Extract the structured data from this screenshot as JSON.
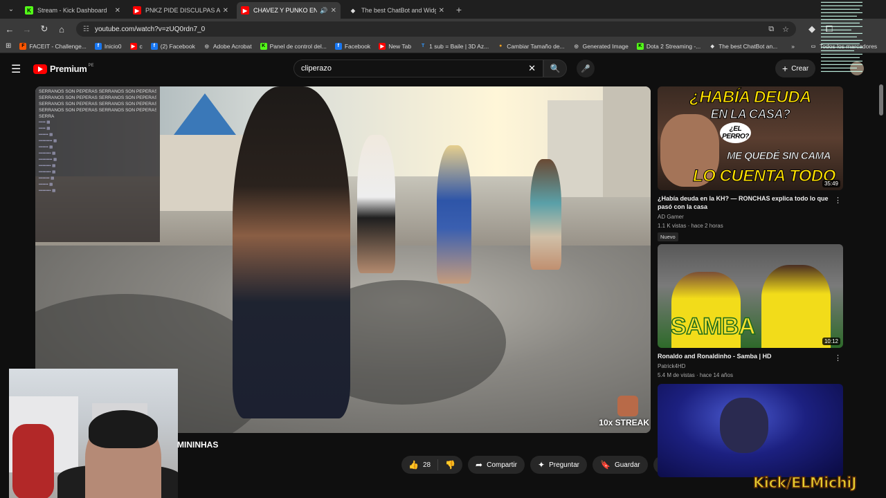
{
  "browser": {
    "tabs": [
      {
        "title": "Stream - Kick Dashboard",
        "favicon": "K",
        "favicon_color": "#53fc18",
        "active": false
      },
      {
        "title": "PNKZ PIDE DISCULPAS A SU FA",
        "favicon": "▶",
        "favicon_color": "#ff0000",
        "active": false
      },
      {
        "title": "CHAVEZ Y PUNKO ENCUEN",
        "favicon": "▶",
        "favicon_color": "#ff0000",
        "active": true
      },
      {
        "title": "The best ChatBot and Widget",
        "favicon": "◆",
        "favicon_color": "#dddddd",
        "active": false
      }
    ],
    "url": "youtube.com/watch?v=zUQ0rdn7_0",
    "bookmarks": [
      {
        "label": "FACEIT - Challenge...",
        "icon": "F",
        "color": "#ff5500"
      },
      {
        "label": "Inicio0",
        "icon": "f",
        "color": "#1877f2"
      },
      {
        "label": "c",
        "icon": "▶",
        "color": "#ff0000"
      },
      {
        "label": "(2) Facebook",
        "icon": "f",
        "color": "#1877f2"
      },
      {
        "label": "Adobe Acrobat",
        "icon": "◎",
        "color": "#888888"
      },
      {
        "label": "Panel de control del...",
        "icon": "K",
        "color": "#53fc18"
      },
      {
        "label": "Facebook",
        "icon": "f",
        "color": "#1877f2"
      },
      {
        "label": "New Tab",
        "icon": "▶",
        "color": "#ff0000"
      },
      {
        "label": "1 sub = Baile | 3D Az...",
        "icon": "T",
        "color": "#3399ff"
      },
      {
        "label": "Cambiar Tamaño de...",
        "icon": "●",
        "color": "#f0a020"
      },
      {
        "label": "Generated Image",
        "icon": "◎",
        "color": "#888888"
      },
      {
        "label": "Dota 2 Streaming -...",
        "icon": "K",
        "color": "#53fc18"
      },
      {
        "label": "The best ChatBot an...",
        "icon": "◆",
        "color": "#dddddd"
      }
    ],
    "bookmarks_folder": "Todos los marcadores"
  },
  "youtube": {
    "logo_text": "Premium",
    "logo_badge": "PE",
    "search_value": "cliperazo",
    "create_label": "Crear",
    "video": {
      "title_partial": "MININHAS",
      "likes": "28",
      "share_label": "Compartir",
      "ask_label": "Preguntar",
      "save_label": "Guardar",
      "streak_text": "10x STREAK"
    },
    "overlay_chat": [
      "SERRANOS SON PEPERAS SERRANOS SON PEPERAS",
      "SERRANOS SON PEPERAS SERRANOS SON PEPERAS",
      "SERRANOS SON PEPERAS SERRANOS SON PEPERAS",
      "SERRANOS SON PEPERAS SERRANOS SON PEPERAS",
      "SERRA"
    ],
    "recommendations": [
      {
        "thumb_top": "¿HABÍA DEUDA",
        "thumb_mid": "EN LA CASA?",
        "thumb_bubble": "¿EL PERRO?",
        "thumb_line3": "ME QUEDÉ SIN CAMA",
        "thumb_line4": "LO CUENTA TODO",
        "duration": "35:49",
        "title": "¿Había deuda en la KH? — RONCHAS explica todo lo que pasó con la casa",
        "channel": "AD Gamer",
        "meta": "1.1 K vistas · hace 2 horas",
        "badge": "Nuevo"
      },
      {
        "thumb_text": "SAMBA",
        "duration": "10:12",
        "title": "Ronaldo and Ronaldinho - Samba | HD",
        "channel": "Patrick4HD",
        "meta": "5.4 M de vistas · hace 14 años"
      },
      {
        "duration": "",
        "title": "",
        "channel": "",
        "meta": ""
      }
    ]
  },
  "stream_overlay": {
    "kick_tag": "Kick/ELMichiJ"
  }
}
